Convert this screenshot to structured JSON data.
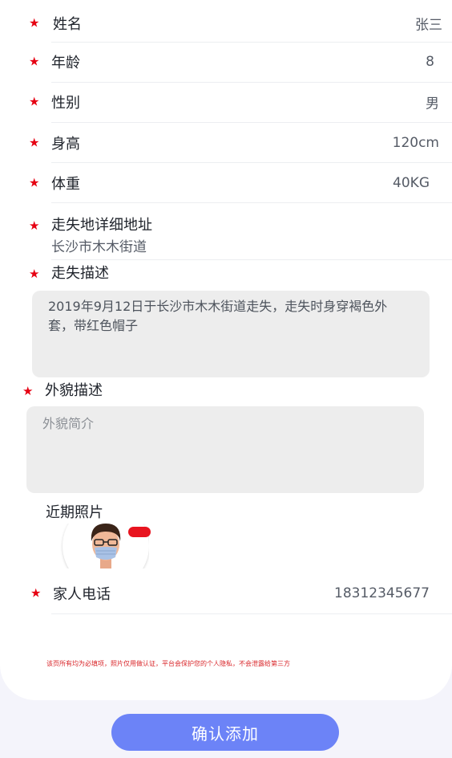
{
  "form": {
    "name": {
      "label": "姓名",
      "value": "张三"
    },
    "age": {
      "label": "年龄",
      "value": "8"
    },
    "gender": {
      "label": "性别",
      "value": "男"
    },
    "height": {
      "label": "身高",
      "value": "120cm"
    },
    "weight": {
      "label": "体重",
      "value": "40KG"
    },
    "address": {
      "label": "走失地详细地址",
      "value": "长沙市木木街道"
    },
    "lost_description": {
      "label": "走失描述",
      "value": "2019年9月12日于长沙市木木街道走失，走失时身穿褐色外套，带红色帽子"
    },
    "appearance": {
      "label": "外貌描述",
      "placeholder": "外貌简介",
      "value": ""
    },
    "photos": {
      "label": "近期照片"
    },
    "family_phone": {
      "label": "家人电话",
      "value": "18312345677"
    },
    "required_mark": "★",
    "notice": "该页所有均为必填项，照片仅用做认证，平台会保护您的个人隐私，不会泄露给第三方"
  },
  "actions": {
    "submit_label": "确认添加"
  },
  "colors": {
    "accent": "#6c83f7",
    "required": "#e60012",
    "badge": "#e8141f",
    "field_bg": "#ededed"
  }
}
